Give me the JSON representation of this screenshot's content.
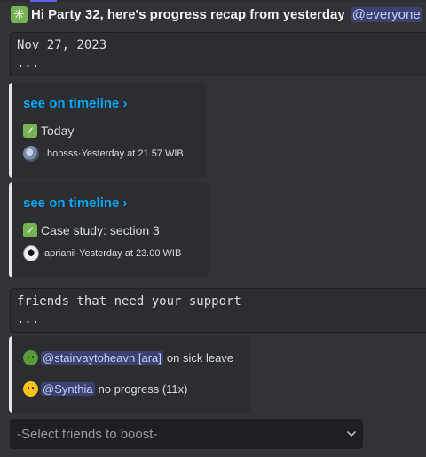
{
  "header": {
    "text": "Hi Party 32, here's progress recap from yesterday",
    "mention": "@everyone"
  },
  "code1": {
    "line1": "Nov 27, 2023",
    "line2": "..."
  },
  "embeds": [
    {
      "link": "see on timeline ›",
      "task": "Today",
      "author": ".hopsss",
      "sep": " · ",
      "time": "Yesterday at 21.57 WIB"
    },
    {
      "link": "see on timeline ›",
      "task": "Case study: section 3",
      "author": "aprianil",
      "sep": " · ",
      "time": "Yesterday at 23.00 WIB"
    }
  ],
  "code2": {
    "line1": "friends that need your support",
    "line2": "..."
  },
  "support": [
    {
      "mention": "@stairvaytoheavn [ara]",
      "status": "on sick leave",
      "icon": "sick-face-icon"
    },
    {
      "mention": "@Synthia",
      "status": "no progress (11x)",
      "icon": "neutral-face-icon"
    }
  ],
  "select": {
    "placeholder": "-Select friends to boost-"
  },
  "colors": {
    "accent_link": "#00a8fc",
    "mention_bg": "#3c4270",
    "check": "#77b255"
  }
}
